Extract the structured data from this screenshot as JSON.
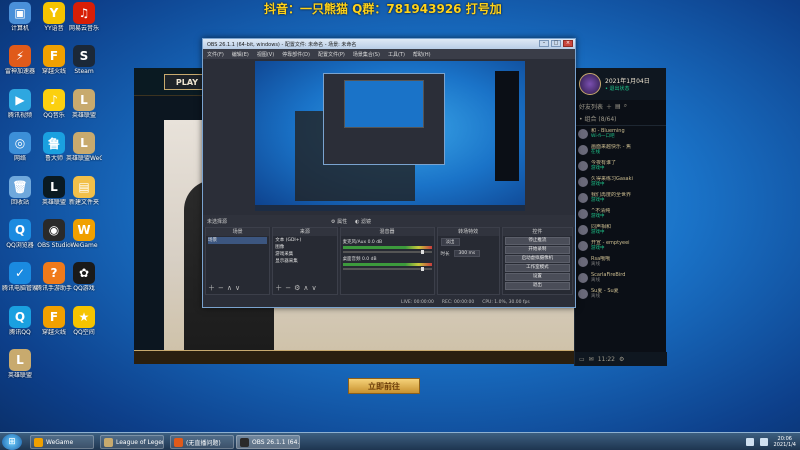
{
  "watermark": "抖音：一只熊猫  Q群：781943926  打号加",
  "desktop_icons": [
    {
      "label": "计算机",
      "color": "#4a90d9",
      "glyph": "▣"
    },
    {
      "label": "YY语音",
      "color": "#f5c400",
      "glyph": "Y"
    },
    {
      "label": "网易云音乐",
      "color": "#d81e06",
      "glyph": "♫"
    },
    {
      "label": "雷神加速器",
      "color": "#e05a1a",
      "glyph": "⚡"
    },
    {
      "label": "穿越火线",
      "color": "#f0a000",
      "glyph": "F"
    },
    {
      "label": "Steam",
      "color": "#1b2838",
      "glyph": "S"
    },
    {
      "label": "腾讯视频",
      "color": "#2ea7e0",
      "glyph": "▶"
    },
    {
      "label": "QQ音乐",
      "color": "#fcd00f",
      "glyph": "♪"
    },
    {
      "label": "英雄联盟",
      "color": "#c8aa6e",
      "glyph": "L"
    },
    {
      "label": "网络",
      "color": "#3c8fd8",
      "glyph": "◎"
    },
    {
      "label": "鲁大师",
      "color": "#1aa0e0",
      "glyph": "鲁"
    },
    {
      "label": "英雄联盟WeGame",
      "color": "#c8aa6e",
      "glyph": "L"
    },
    {
      "label": "回收站",
      "color": "#6fa8dc",
      "glyph": "🗑"
    },
    {
      "label": "英雄联盟",
      "color": "#0a1a22",
      "glyph": "L"
    },
    {
      "label": "新建文件夹",
      "color": "#f2c04a",
      "glyph": "▤"
    },
    {
      "label": "QQ浏览器",
      "color": "#1b8be0",
      "glyph": "Q"
    },
    {
      "label": "OBS Studio",
      "color": "#2a2a2a",
      "glyph": "◉"
    },
    {
      "label": "WeGame",
      "color": "#f0a000",
      "glyph": "W"
    },
    {
      "label": "腾讯电脑管家",
      "color": "#1a8ae0",
      "glyph": "✓"
    },
    {
      "label": "腾讯手游助手",
      "color": "#f07a1a",
      "glyph": "?"
    },
    {
      "label": "QQ游戏",
      "color": "#1a1a1a",
      "glyph": "✿"
    },
    {
      "label": "腾讯QQ",
      "color": "#1aa0e0",
      "glyph": "Q"
    },
    {
      "label": "穿越火线",
      "color": "#f0a000",
      "glyph": "F"
    },
    {
      "label": "QQ空间",
      "color": "#f5c400",
      "glyph": "★"
    },
    {
      "label": "英雄联盟",
      "color": "#c8aa6e",
      "glyph": "L"
    }
  ],
  "game": {
    "play_label": "PLAY",
    "enter_label": "立即前往"
  },
  "friends": {
    "date": "2021年1月04日",
    "status": "• 退出状态",
    "header": "好友列表",
    "group": "• 组合 (8/64)",
    "list": [
      {
        "name": "和 - Blueming",
        "status": "Wi-fi一口吧",
        "online": true
      },
      {
        "name": "画面来越快乐 - 焦",
        "status": "在线",
        "online": true
      },
      {
        "name": "今夜有谁了",
        "status": "游戏中",
        "online": true
      },
      {
        "name": "久得来练习Gasaki",
        "status": "游戏中",
        "online": true
      },
      {
        "name": "我们再度的全世界",
        "status": "游戏中",
        "online": true
      },
      {
        "name": "^不清纯",
        "status": "游戏中",
        "online": true
      },
      {
        "name": "同声相和",
        "status": "游戏中",
        "online": true
      },
      {
        "name": "开宣 - emptyeei",
        "status": "游戏中",
        "online": true
      },
      {
        "name": "Rsa哦哦",
        "status": "离线",
        "online": false
      },
      {
        "name": "ScarlaFireBird",
        "status": "离线",
        "online": false
      },
      {
        "name": "Su夏 - Su夏",
        "status": "离线",
        "online": false
      }
    ],
    "bottom_time": "11:22"
  },
  "obs": {
    "title": "OBS 26.1.1 (64-bit, windows) - 配置文件: 未命名 - 场景: 未命名",
    "menu": [
      "文件(F)",
      "编辑(E)",
      "视图(V)",
      "停靠部件(D)",
      "配置文件(P)",
      "场景集合(S)",
      "工具(T)",
      "帮助(H)"
    ],
    "scene_bar": "未选择源",
    "scene_tabs": [
      "⚙ 属性",
      "◐ 滤镜"
    ],
    "docks": {
      "scenes": {
        "title": "场景",
        "items": [
          "场景"
        ]
      },
      "sources": {
        "title": "来源",
        "items": [
          "文本 (GDI+)",
          "图像",
          "游戏采集",
          "显示器采集"
        ]
      },
      "mixer": {
        "title": "混音器",
        "channels": [
          {
            "name": "麦克风/Aux",
            "db": "0.0 dB"
          },
          {
            "name": "桌面音频",
            "db": "0.0 dB"
          }
        ]
      },
      "transitions": {
        "title": "转场特效",
        "type": "淡出",
        "duration_label": "时长",
        "duration": "300 ms"
      },
      "controls": {
        "title": "控件",
        "buttons": [
          "停止推流",
          "开始录制",
          "启动虚拟摄像机",
          "工作室模式",
          "设置",
          "退出"
        ]
      }
    },
    "status": [
      "LIVE: 00:00:00",
      "REC: 00:00:00",
      "CPU: 1.0%, 30.00 fps"
    ]
  },
  "taskbar": {
    "items": [
      {
        "label": "WeGame",
        "color": "#f0a000"
      },
      {
        "label": "League of Legen...",
        "color": "#c8aa6e"
      },
      {
        "label": "(无直播问题)",
        "color": "#e05a1a"
      },
      {
        "label": "OBS 26.1.1 (64...",
        "color": "#2a2a2a"
      }
    ],
    "time": "20:06",
    "date": "2021/1/4"
  }
}
